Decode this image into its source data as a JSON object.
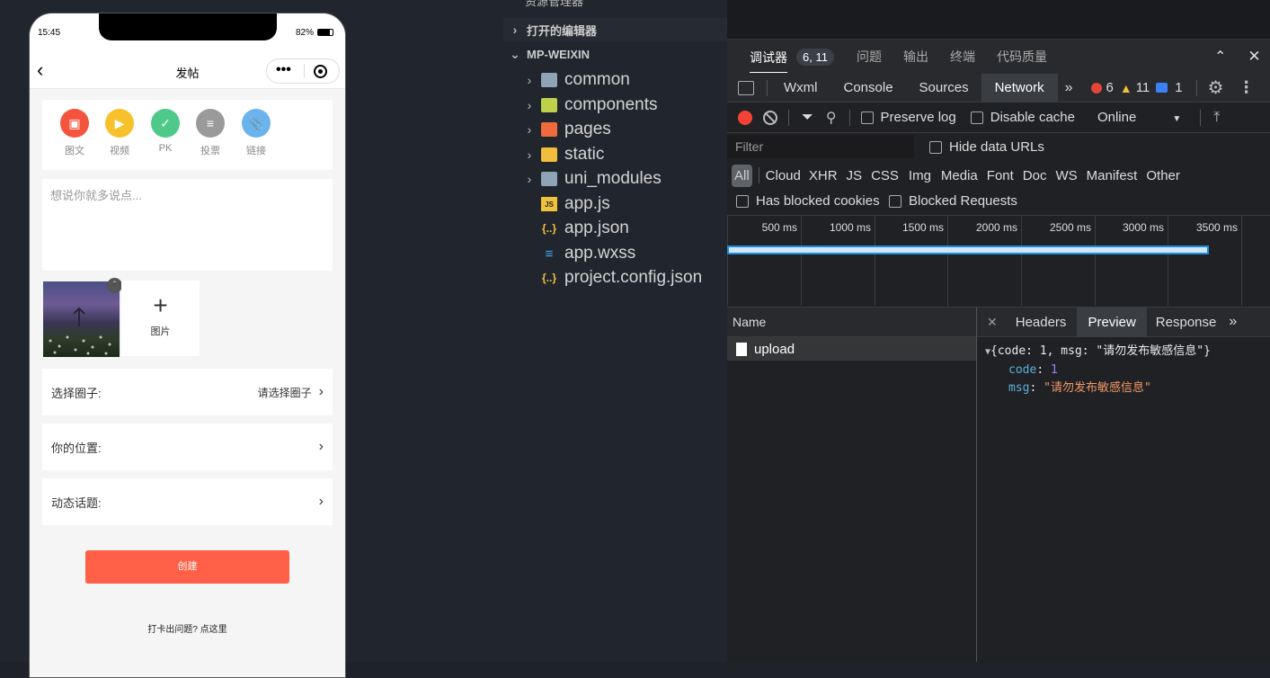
{
  "simulator": {
    "status": {
      "time": "15:45",
      "battery": "82%"
    },
    "nav": {
      "title": "发帖"
    },
    "tools": [
      {
        "label": "图文",
        "icon": "image-icon",
        "color": "#f4533d"
      },
      {
        "label": "视频",
        "icon": "video-icon",
        "color": "#f7c12c"
      },
      {
        "label": "PK",
        "icon": "check-icon",
        "color": "#4fc98a"
      },
      {
        "label": "投票",
        "icon": "vote-icon",
        "color": "#9a9a9a"
      },
      {
        "label": "链接",
        "icon": "link-icon",
        "color": "#6cb3ee"
      }
    ],
    "textarea_placeholder": "想说你就多说点...",
    "add_image_label": "图片",
    "rows": [
      {
        "label": "选择圈子:",
        "value": "请选择圈子"
      },
      {
        "label": "你的位置:",
        "value": ""
      },
      {
        "label": "动态话题:",
        "value": ""
      }
    ],
    "create_button": "创建",
    "footer_hint": "打卡出问题? 点这里",
    "accent": "#ff6047"
  },
  "explorer": {
    "top_cut": "资源管理器",
    "open_editors": "打开的编辑器",
    "project": "MP-WEIXIN",
    "items": [
      {
        "name": "common",
        "type": "folder"
      },
      {
        "name": "components",
        "type": "folder"
      },
      {
        "name": "pages",
        "type": "folder"
      },
      {
        "name": "static",
        "type": "folder"
      },
      {
        "name": "uni_modules",
        "type": "folder"
      },
      {
        "name": "app.js",
        "type": "js"
      },
      {
        "name": "app.json",
        "type": "json"
      },
      {
        "name": "app.wxss",
        "type": "css"
      },
      {
        "name": "project.config.json",
        "type": "json"
      }
    ]
  },
  "devtools": {
    "tabs": [
      {
        "label": "调试器"
      },
      {
        "label": "问题"
      },
      {
        "label": "输出"
      },
      {
        "label": "终端"
      },
      {
        "label": "代码质量"
      }
    ],
    "debugger_badge": "6, 11",
    "panels": [
      "Wxml",
      "Console",
      "Sources",
      "Network"
    ],
    "errors": "6",
    "warnings": "11",
    "messages": "1",
    "network": {
      "preserve_log": "Preserve log",
      "disable_cache": "Disable cache",
      "throttle": "Online",
      "filter_placeholder": "Filter",
      "hide_data_urls": "Hide data URLs",
      "types": [
        "All",
        "Cloud",
        "XHR",
        "JS",
        "CSS",
        "Img",
        "Media",
        "Font",
        "Doc",
        "WS",
        "Manifest",
        "Other"
      ],
      "has_blocked_cookies": "Has blocked cookies",
      "blocked_requests": "Blocked Requests",
      "ticks": [
        "500 ms",
        "1000 ms",
        "1500 ms",
        "2000 ms",
        "2500 ms",
        "3000 ms",
        "3500 ms"
      ],
      "name_header": "Name",
      "requests": [
        "upload"
      ],
      "detail_tabs": [
        "Headers",
        "Preview",
        "Response"
      ],
      "preview": {
        "summary": "{code: 1, msg: \"请勿发布敏感信息\"}",
        "code_key": "code",
        "code_val": "1",
        "msg_key": "msg",
        "msg_val": "\"请勿发布敏感信息\""
      }
    }
  }
}
